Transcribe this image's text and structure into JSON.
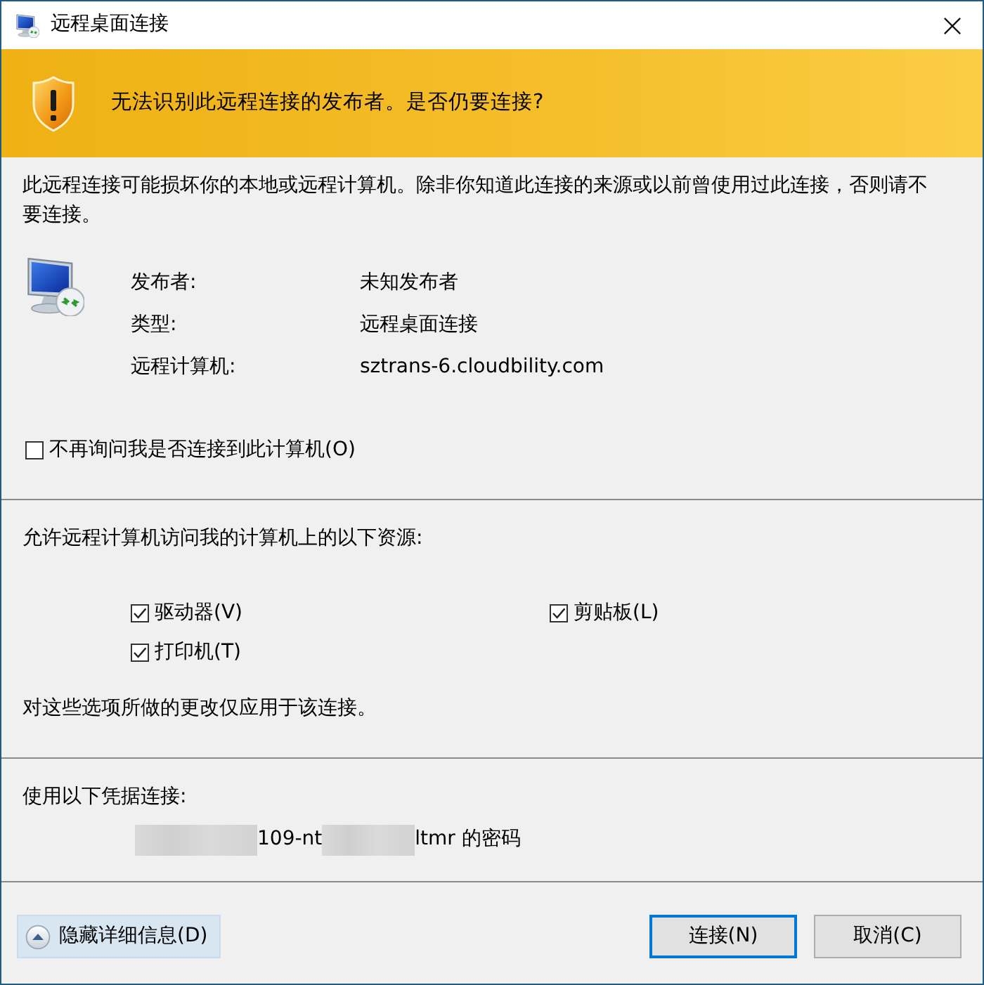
{
  "window": {
    "title": "远程桌面连接"
  },
  "warning": {
    "heading": "无法识别此远程连接的发布者。是否仍要连接?"
  },
  "description": "此远程连接可能损坏你的本地或远程计算机。除非你知道此连接的来源或以前曾使用过此连接，否则请不要连接。",
  "details": [
    {
      "label": "发布者:",
      "value": "未知发布者"
    },
    {
      "label": "类型:",
      "value": "远程桌面连接"
    },
    {
      "label": "远程计算机:",
      "value": "sztrans-6.cloudbility.com"
    }
  ],
  "dont_ask": {
    "label": "不再询问我是否连接到此计算机(O)",
    "checked": false
  },
  "resources": {
    "heading": "允许远程计算机访问我的计算机上的以下资源:",
    "options": [
      {
        "label": "驱动器(V)",
        "checked": true
      },
      {
        "label": "剪贴板(L)",
        "checked": true
      },
      {
        "label": "打印机(T)",
        "checked": true
      }
    ],
    "note": "对这些选项所做的更改仅应用于该连接。"
  },
  "credentials": {
    "heading": "使用以下凭据连接:",
    "parts": [
      {
        "kind": "redacted"
      },
      {
        "kind": "text",
        "text": "109-nt"
      },
      {
        "kind": "redacted"
      },
      {
        "kind": "text",
        "text": "ltmr 的密码"
      }
    ]
  },
  "footer": {
    "details_toggle": "隐藏详细信息(D)",
    "buttons": [
      {
        "label": "连接(N)",
        "kind": "default"
      },
      {
        "label": "取消(C)",
        "kind": "normal"
      }
    ]
  }
}
